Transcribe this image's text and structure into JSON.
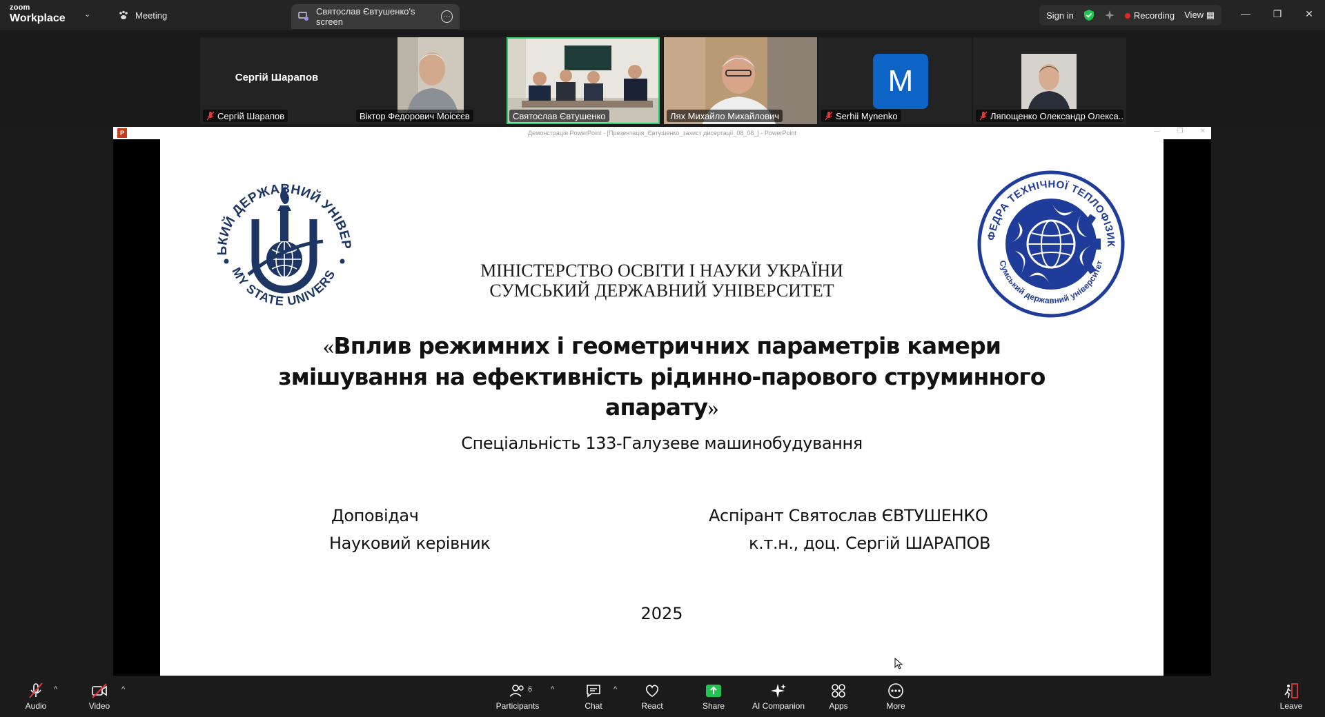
{
  "titlebar": {
    "brand_top": "zoom",
    "brand_bottom": "Workplace",
    "tab_meeting": "Meeting",
    "tab_screen": "Святослав Євтушенко's screen",
    "sign_in": "Sign in",
    "recording": "Recording",
    "view": "View"
  },
  "participants": [
    {
      "name": "Сергій Шарапов",
      "big_name": "Сергій Шарапов",
      "muted": true
    },
    {
      "name": "Віктор Федорович Моісєєв",
      "muted": false
    },
    {
      "name": "Святослав Євтушенко",
      "muted": false,
      "active": true
    },
    {
      "name": "Лях Михайло Михайлович",
      "muted": false
    },
    {
      "name": "Serhii Mynenko",
      "avatar_letter": "M",
      "muted": true
    },
    {
      "name": "Ляпощенко Олександр Олекса...",
      "muted": true
    }
  ],
  "ppt": {
    "window_title": "Демонстрація PowerPoint - [Презентація_Євтушенко_захист дисертації_08_08_] - PowerPoint"
  },
  "slide": {
    "ministry_line1": "МІНІСТЕРСТВО ОСВІТИ І НАУКИ УКРАЇНИ",
    "ministry_line2": "СУМСЬКИЙ ДЕРЖАВНИЙ УНІВЕРСИТЕТ",
    "quote_open": "«",
    "title": "Вплив режимних і геометричних параметрів камери змішування на ефективність рідинно-парового струминного апарату",
    "quote_close": "»",
    "specialty": "Спеціальність 133-Галузеве машинобудування",
    "speaker_role": "Доповідач",
    "speaker_name": "Аспірант Святослав ЄВТУШЕНКО",
    "advisor_role": "Науковий керівник",
    "advisor_name": "к.т.н., доц. Сергій ШАРАПОВ",
    "year": "2025",
    "logo_left_ring_top": "СУМСЬКИЙ ДЕРЖАВНИЙ УНІВЕРСИТЕТ",
    "logo_left_ring_bottom": "SUMY STATE UNIVERSITY",
    "logo_right_ring_top": "КАФЕДРА ТЕХНІЧНОЇ ТЕПЛОФІЗИКИ",
    "logo_right_ring_bottom": "Сумський державний університет"
  },
  "toolbar": {
    "audio": "Audio",
    "video": "Video",
    "participants": "Participants",
    "participants_count": "6",
    "chat": "Chat",
    "react": "React",
    "share": "Share",
    "ai_companion": "AI Companion",
    "apps": "Apps",
    "more": "More",
    "leave": "Leave"
  },
  "colors": {
    "active_speaker": "#2bcf6b",
    "recording": "#e02828",
    "share_green": "#23c552",
    "sumdu_navy": "#1c3563",
    "dept_blue": "#1f3c9a",
    "avatar_blue": "#0e63c6"
  }
}
